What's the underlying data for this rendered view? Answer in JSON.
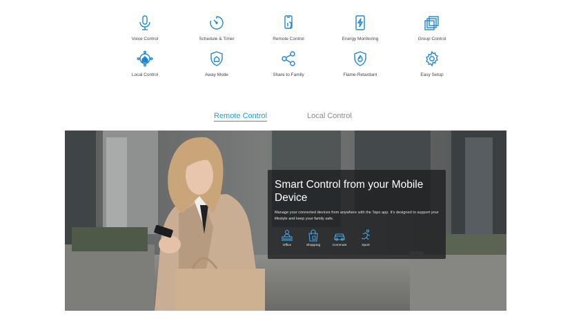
{
  "features": [
    {
      "label": "Voice Control",
      "icon": "microphone-icon"
    },
    {
      "label": "Schedule & Timer",
      "icon": "timer-icon"
    },
    {
      "label": "Remote Control",
      "icon": "phone-hand-icon"
    },
    {
      "label": "Energy Monitoring",
      "icon": "phone-energy-icon"
    },
    {
      "label": "Group Control",
      "icon": "stacked-squares-icon"
    },
    {
      "label": "Local Control",
      "icon": "home-network-icon"
    },
    {
      "label": "Away Mode",
      "icon": "shield-home-icon"
    },
    {
      "label": "Share to Family",
      "icon": "share-icon"
    },
    {
      "label": "Flame-Retardant",
      "icon": "shield-flame-icon"
    },
    {
      "label": "Easy Setup",
      "icon": "gear-icon"
    }
  ],
  "tabs": {
    "remote": "Remote Control",
    "local": "Local Control"
  },
  "colors": {
    "accent": "#1a9ed8",
    "icon_blue": "#1c86d8"
  },
  "hero": {
    "title": "Smart Control from your Mobile Device",
    "description": "Manage your connected devices from anywhere with the Tapo app. It's designed to support your lifestyle and keep your family safe.",
    "uses": [
      {
        "label": "Office",
        "icon": "office-desk-icon"
      },
      {
        "label": "Shopping",
        "icon": "shopping-bag-icon"
      },
      {
        "label": "Commute",
        "icon": "car-icon"
      },
      {
        "label": "Sport",
        "icon": "running-icon"
      }
    ]
  }
}
